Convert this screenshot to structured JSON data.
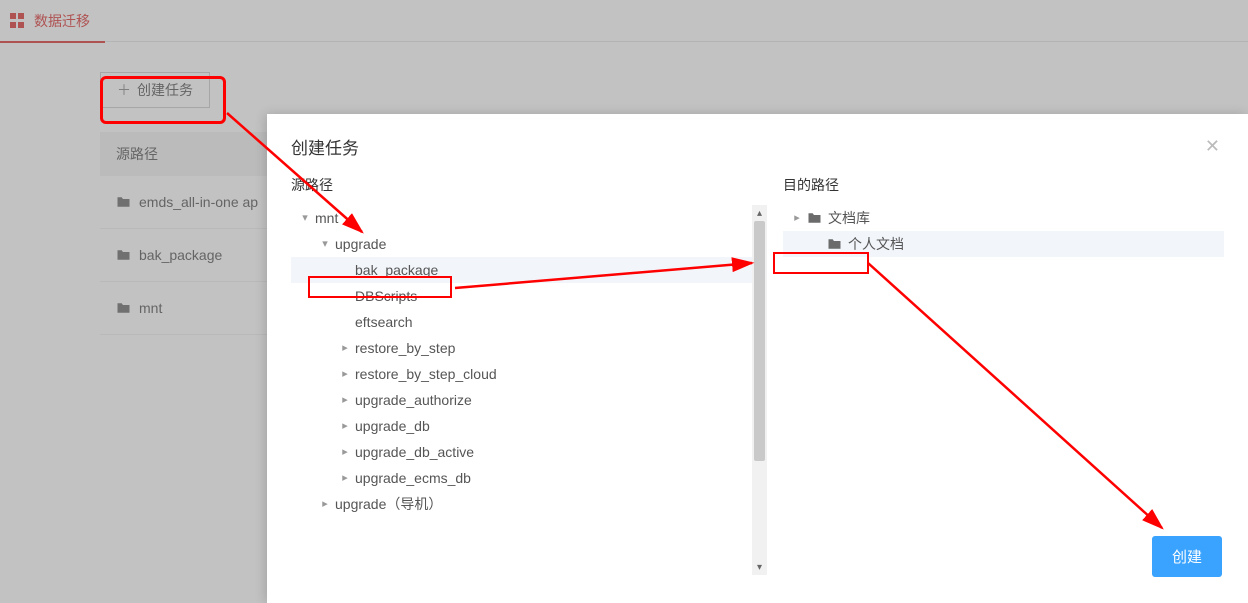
{
  "topbar": {
    "title": "数据迁移"
  },
  "toolbar": {
    "create_task": "创建任务"
  },
  "table": {
    "header_source": "源路径",
    "rows": [
      {
        "name": "emds_all-in-one ap"
      },
      {
        "name": "bak_package"
      },
      {
        "name": "mnt"
      }
    ]
  },
  "dialog": {
    "title": "创建任务",
    "source_label": "源路径",
    "dest_label": "目的路径",
    "submit": "创建",
    "source_tree": [
      {
        "indent": 0,
        "toggle": "▾",
        "label": "mnt"
      },
      {
        "indent": 1,
        "toggle": "▾",
        "label": "upgrade"
      },
      {
        "indent": 2,
        "toggle": "",
        "label": "bak_package",
        "selected": true
      },
      {
        "indent": 2,
        "toggle": "",
        "label": "DBScripts"
      },
      {
        "indent": 2,
        "toggle": "",
        "label": "eftsearch"
      },
      {
        "indent": 2,
        "toggle": "▸",
        "label": "restore_by_step"
      },
      {
        "indent": 2,
        "toggle": "▸",
        "label": "restore_by_step_cloud"
      },
      {
        "indent": 2,
        "toggle": "▸",
        "label": "upgrade_authorize"
      },
      {
        "indent": 2,
        "toggle": "▸",
        "label": "upgrade_db"
      },
      {
        "indent": 2,
        "toggle": "▸",
        "label": "upgrade_db_active"
      },
      {
        "indent": 2,
        "toggle": "▸",
        "label": "upgrade_ecms_db"
      },
      {
        "indent": 1,
        "toggle": "▸",
        "label": "upgrade（导机）"
      }
    ],
    "dest_tree": [
      {
        "indent": 0,
        "toggle": "▸",
        "icon": true,
        "label": "文档库"
      },
      {
        "indent": 1,
        "toggle": "",
        "icon": true,
        "label": "个人文档",
        "selected": true
      }
    ]
  }
}
